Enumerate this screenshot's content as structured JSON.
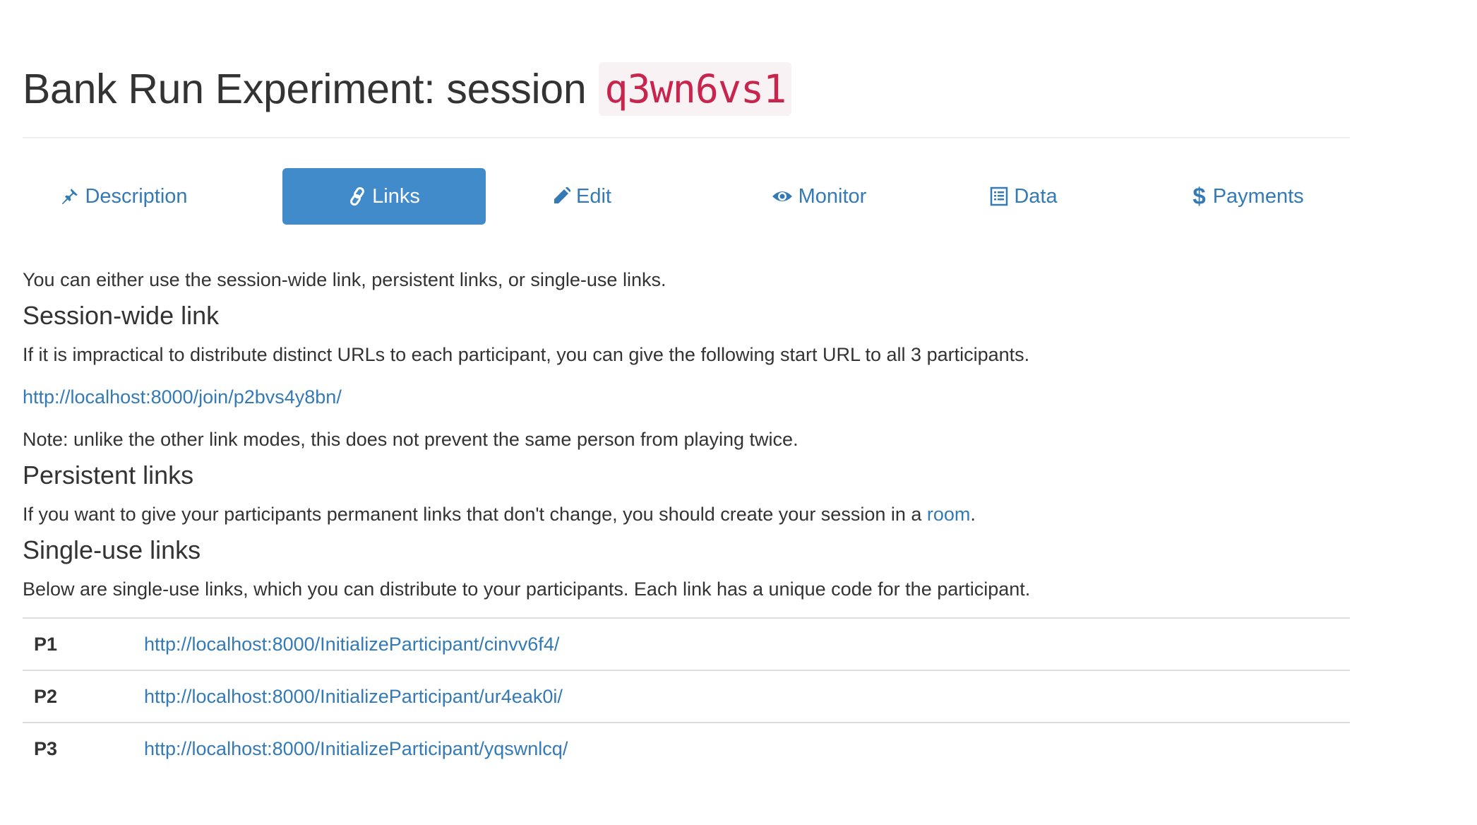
{
  "header": {
    "title": "Bank Run Experiment: session",
    "session_code": "q3wn6vs1"
  },
  "nav": {
    "tabs": [
      {
        "label": "Description",
        "icon": "pushpin-icon",
        "active": false
      },
      {
        "label": "Links",
        "icon": "link-icon",
        "active": true
      },
      {
        "label": "Edit",
        "icon": "pencil-icon",
        "active": false
      },
      {
        "label": "Monitor",
        "icon": "eye-icon",
        "active": false
      },
      {
        "label": "Data",
        "icon": "list-alt-icon",
        "active": false
      },
      {
        "label": "Payments",
        "icon": "dollar-icon",
        "active": false
      }
    ]
  },
  "content": {
    "intro": "You can either use the session-wide link, persistent links, or single-use links.",
    "session_wide": {
      "heading": "Session-wide link",
      "description": "If it is impractical to distribute distinct URLs to each participant, you can give the following start URL to all 3 participants.",
      "url": "http://localhost:8000/join/p2bvs4y8bn/",
      "note": "Note: unlike the other link modes, this does not prevent the same person from playing twice."
    },
    "persistent": {
      "heading": "Persistent links",
      "description_before": "If you want to give your participants permanent links that don't change, you should create your session in a ",
      "room_link": "room",
      "description_after": "."
    },
    "single_use": {
      "heading": "Single-use links",
      "description": "Below are single-use links, which you can distribute to your participants. Each link has a unique code for the participant.",
      "rows": [
        {
          "label": "P1",
          "url": "http://localhost:8000/InitializeParticipant/cinvv6f4/"
        },
        {
          "label": "P2",
          "url": "http://localhost:8000/InitializeParticipant/ur4eak0i/"
        },
        {
          "label": "P3",
          "url": "http://localhost:8000/InitializeParticipant/yqswnlcq/"
        }
      ]
    }
  },
  "colors": {
    "link": "#337ab7",
    "active_pill": "#428bca",
    "code_text": "#c7254e",
    "code_bg": "#f9f2f4"
  }
}
